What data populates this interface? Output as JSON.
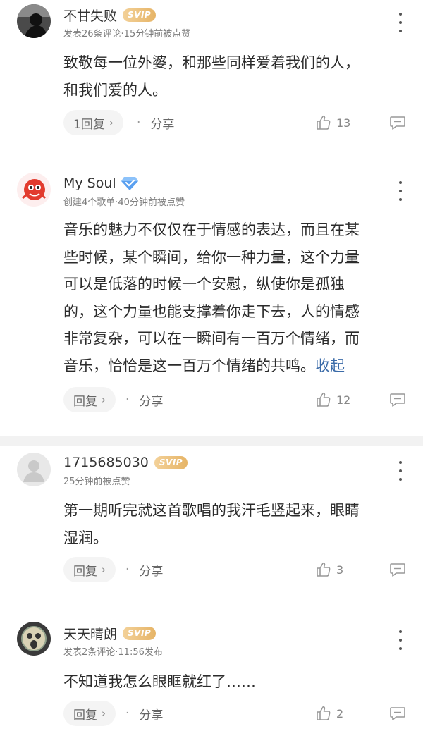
{
  "comments": [
    {
      "username": "不甘失败",
      "badge": "SVIP",
      "meta": "发表26条评论·15分钟前被点赞",
      "content_lines": [
        "致敬每一位外婆，和那些同样爱着我们的人，",
        "和我们爱的人。"
      ],
      "collapse_label": "",
      "reply_label": "1回复",
      "share_label": "分享",
      "like_count": "13"
    },
    {
      "username": "My Soul",
      "badge": "",
      "meta": "创建4个歌单·40分钟前被点赞",
      "content_lines": [
        "音乐的魅力不仅仅在于情感的表达，而且在某",
        "些时候，某个瞬间，给你一种力量，这个力量",
        "可以是低落的时候一个安慰，纵使你是孤独",
        "的，这个力量也能支撑着你走下去，人的情感",
        "非常复杂，可以在一瞬间有一百万个情绪，而",
        "音乐，恰恰是这一百万个情绪的共鸣。"
      ],
      "collapse_label": "收起",
      "reply_label": "回复",
      "share_label": "分享",
      "like_count": "12"
    },
    {
      "username": "1715685030",
      "badge": "SVIP",
      "meta": "25分钟前被点赞",
      "content_lines": [
        "第一期听完就这首歌唱的我汗毛竖起来，眼睛",
        "湿润。"
      ],
      "collapse_label": "",
      "reply_label": "回复",
      "share_label": "分享",
      "like_count": "3"
    },
    {
      "username": "天天晴朗",
      "badge": "SVIP",
      "meta": "发表2条评论·11:56发布",
      "content_lines": [
        "不知道我怎么眼眶就红了……"
      ],
      "collapse_label": "",
      "reply_label": "回复",
      "share_label": "分享",
      "like_count": "2"
    }
  ],
  "icons": {
    "more": "more-vertical-icon",
    "like": "thumbs-up-icon",
    "reply": "comment-icon",
    "verified": "diamond-verified-icon"
  },
  "colors": {
    "svip_gold": "#e6b466",
    "link_blue": "#3b6ba8",
    "verified_blue": "#5aa0f0"
  }
}
